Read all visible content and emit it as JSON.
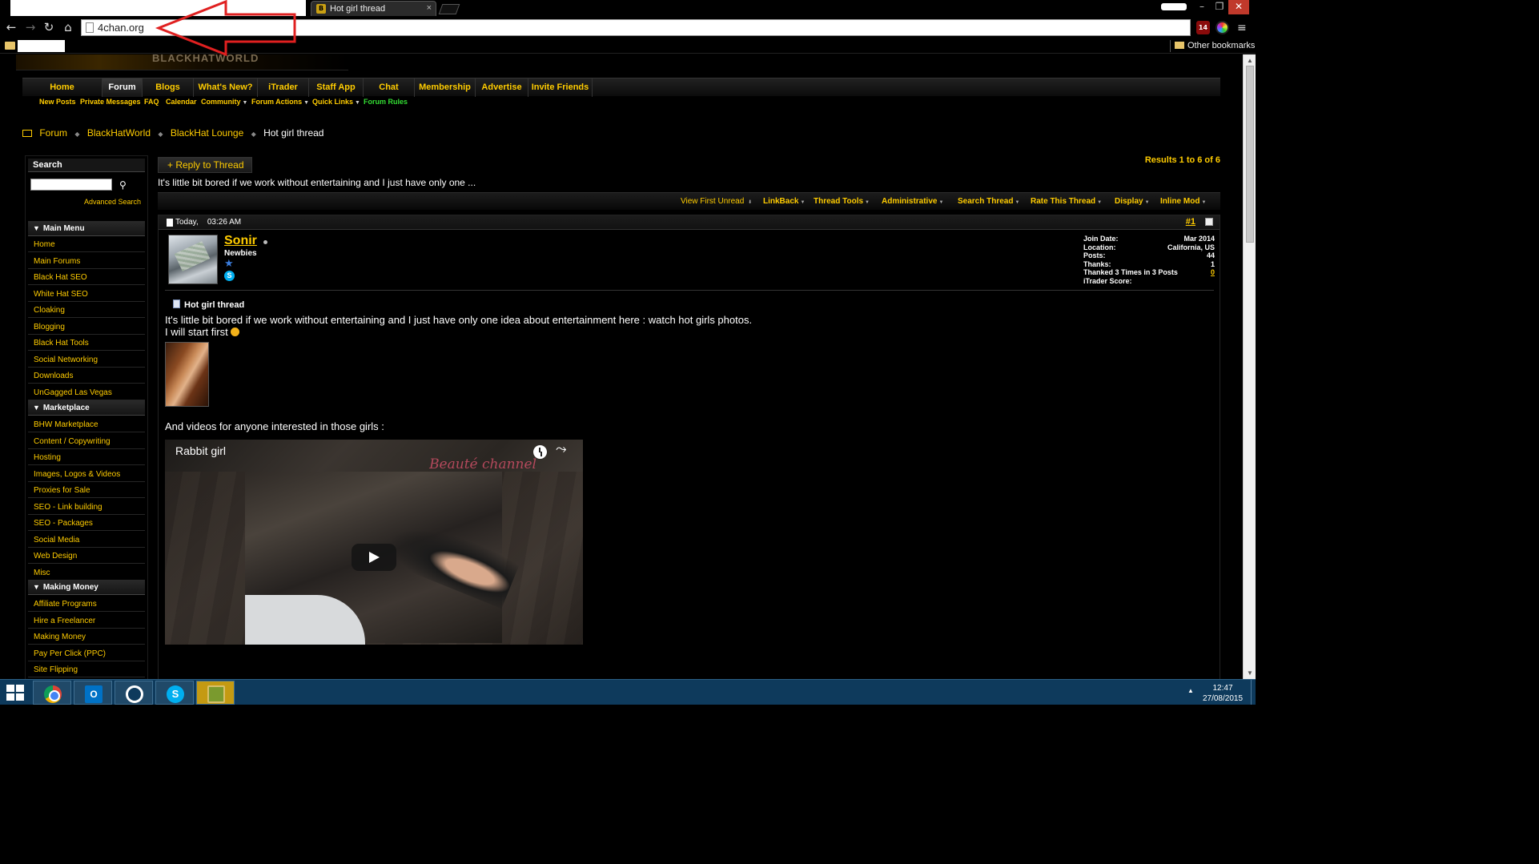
{
  "browser": {
    "tab_title": "Hot girl thread",
    "url": "4chan.org",
    "bookmarks": {
      "other": "Other bookmarks"
    },
    "ext_badge": "14"
  },
  "forum": {
    "logo_text": "BLACKHATWORLD",
    "main_nav": [
      "Home",
      "Forum",
      "Blogs",
      "What's New?",
      "iTrader",
      "Staff App",
      "Chat",
      "Membership",
      "Advertise",
      "Invite Friends"
    ],
    "sub_nav": [
      "New Posts",
      "Private Messages",
      "FAQ",
      "Calendar",
      "Community",
      "Forum Actions",
      "Quick Links",
      "Forum Rules"
    ],
    "breadcrumb": [
      "Forum",
      "BlackHatWorld",
      "BlackHat Lounge",
      "Hot girl thread"
    ]
  },
  "sidebar": {
    "search_title": "Search",
    "advanced_search": "Advanced Search",
    "sections": [
      {
        "title": "Main Menu",
        "items": [
          "Home",
          "Main Forums",
          "Black Hat SEO",
          "White Hat SEO",
          "Cloaking",
          "Blogging",
          "Black Hat Tools",
          "Social Networking",
          "Downloads",
          "UnGagged Las Vegas"
        ]
      },
      {
        "title": "Marketplace",
        "items": [
          "BHW Marketplace",
          "Content / Copywriting",
          "Hosting",
          "Images, Logos & Videos",
          "Proxies for Sale",
          "SEO - Link building",
          "SEO - Packages",
          "Social Media",
          "Web Design",
          "Misc"
        ]
      },
      {
        "title": "Making Money",
        "items": [
          "Affiliate Programs",
          "Hire a Freelancer",
          "Making Money",
          "Pay Per Click (PPC)",
          "Site Flipping"
        ]
      }
    ]
  },
  "thread": {
    "reply_button": "Reply to Thread",
    "results": "Results 1 to 6 of 6",
    "description": "It's little bit bored if we work without entertaining and I just have only one ...",
    "tools": [
      "View First Unread",
      "LinkBack",
      "Thread Tools",
      "Administrative",
      "Search Thread",
      "Rate This Thread",
      "Display",
      "Inline Mod"
    ]
  },
  "post": {
    "date": "Today,",
    "time": "03:26 AM",
    "number": "#1",
    "username": "Sonir",
    "rank": "Newbies",
    "user_info": [
      {
        "label": "Join Date:",
        "value": "Mar 2014"
      },
      {
        "label": "Location:",
        "value": "California, US"
      },
      {
        "label": "Posts:",
        "value": "44"
      },
      {
        "label": "Thanks:",
        "value": "1"
      },
      {
        "label": "Thanked 3 Times in 3 Posts",
        "value": "0"
      },
      {
        "label": "iTrader Score:",
        "value": ""
      }
    ],
    "title": "Hot girl thread",
    "body_line1": "It's little bit bored if we work without entertaining and I just have only one idea about entertainment here : watch hot girls photos.",
    "body_line2": "I will start first",
    "body_line3": "And videos for anyone interested in those girls :",
    "video_title": "Rabbit girl",
    "video_brand": "Beauté channel"
  },
  "taskbar": {
    "time": "12:47",
    "date": "27/08/2015"
  },
  "colors": {
    "accent": "#ffcc00",
    "annotation": "#e02020",
    "taskbar": "#0e3a5c"
  }
}
